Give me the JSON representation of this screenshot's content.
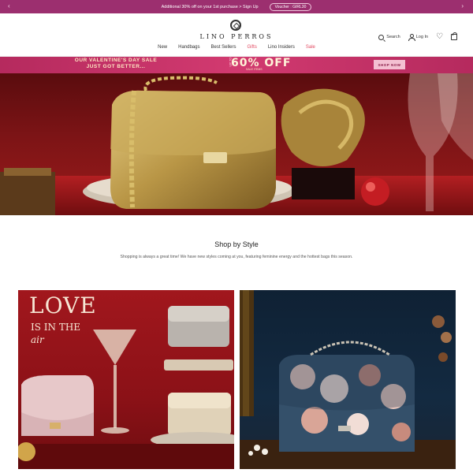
{
  "announcement": {
    "message": "Additional 30% off on your 1st purchase > Sign Up",
    "voucher": "Voucher : GIRL30"
  },
  "header": {
    "brand": "LINO PERROS",
    "nav": [
      "New",
      "Handbags",
      "Best Sellers",
      "Gifts",
      "Lino Insiders",
      "Sale"
    ],
    "search_label": "Search",
    "login_label": "Log In"
  },
  "promo": {
    "title_line1": "OUR VALENTINE'S DAY SALE",
    "title_line2": "JUST GOT BETTER...",
    "upto": "UP TO",
    "big": "60% OFF",
    "sub": "SALE ITEMS",
    "cta": "SHOP NOW"
  },
  "section": {
    "title": "Shop by Style",
    "description": "Shopping is always a great time! We have new styles coming at you, featuring feminine energy and the hottest bags this season."
  },
  "tiles": {
    "left": {
      "headline": "LOVE",
      "line2": "IS IN THE",
      "line3": "air"
    }
  },
  "colors": {
    "announcement_bg": "#9c2f6f",
    "promo_bg": "#c8326a",
    "accent_red": "#e24a62"
  }
}
